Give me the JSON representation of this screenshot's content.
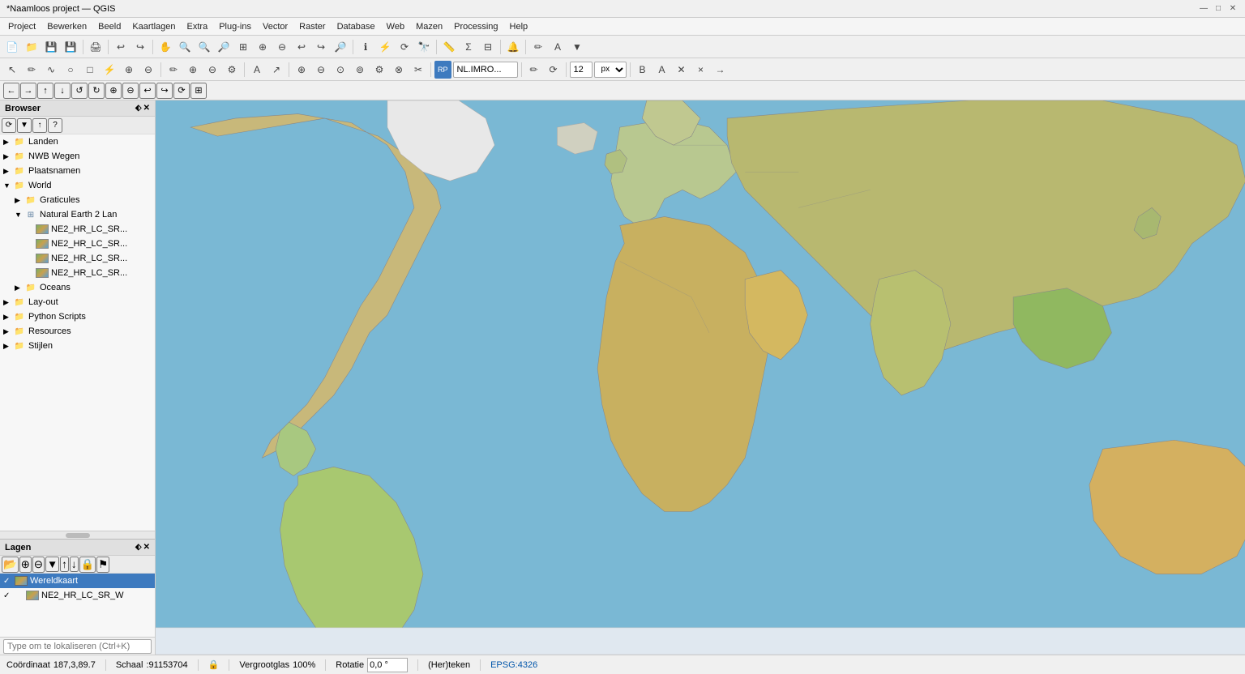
{
  "titlebar": {
    "title": "*Naamloos project — QGIS",
    "minimize": "—",
    "maximize": "□",
    "close": "✕"
  },
  "menubar": {
    "items": [
      "Project",
      "Bewerken",
      "Beeld",
      "Kaartlagen",
      "Extra",
      "Plug-ins",
      "Vector",
      "Raster",
      "Database",
      "Web",
      "Mazen",
      "Processing",
      "Help"
    ]
  },
  "toolbar1": {
    "buttons": [
      "📁",
      "💾",
      "🖨",
      "↩",
      "↪",
      "✂",
      "📋",
      "📄",
      "🔍",
      "🔍",
      "🔍",
      "🔎",
      "⊕",
      "⊖",
      "🔎",
      "↩",
      "↪",
      "🔎",
      "📤",
      "📥",
      "⚡",
      "⟳",
      "🔭",
      "⚙",
      "≡",
      "⚙",
      "Σ",
      "⊟",
      "🔔",
      "✏",
      "A",
      "▼"
    ]
  },
  "toolbar2": {
    "buttons": [
      "↖",
      "✏",
      "∿",
      "○",
      "□",
      "⚡",
      "⊕",
      "⊖",
      "✏",
      "⊕",
      "⊖",
      "⚙",
      "A",
      "↗",
      "⚡",
      "↔",
      "⊕",
      "⊖",
      "⊙",
      "⊚",
      "⚙",
      "⊗",
      "✂",
      "⊞",
      "🔗",
      "RP",
      "NL.IMRO...",
      "✏",
      "⟳",
      "⚙",
      "12",
      "px",
      "▼",
      "✓",
      "⊕",
      "✕",
      "×",
      "→",
      "⚙",
      "▼",
      "⚙",
      "▼",
      "⚙",
      "▼",
      "⚙",
      "▼"
    ]
  },
  "toolbar3": {
    "buttons": [
      "←",
      "→",
      "↑",
      "↓",
      "↺",
      "↻",
      "⊕",
      "⊖",
      "↩",
      "↪",
      "⟳",
      "⊞",
      "↗",
      "↘",
      "←",
      "→",
      "⊕",
      "⊖",
      "⟳",
      "↩"
    ]
  },
  "browser": {
    "title": "Browser",
    "tree": [
      {
        "id": "landen",
        "label": "Landen",
        "indent": 0,
        "arrow": "▶",
        "icon": "folder",
        "expanded": false
      },
      {
        "id": "nwb-wegen",
        "label": "NWB Wegen",
        "indent": 0,
        "arrow": "▶",
        "icon": "folder",
        "expanded": false
      },
      {
        "id": "plaatsnamen",
        "label": "Plaatsnamen",
        "indent": 0,
        "arrow": "▶",
        "icon": "folder",
        "expanded": false
      },
      {
        "id": "world",
        "label": "World",
        "indent": 0,
        "arrow": "▼",
        "icon": "folder",
        "expanded": true
      },
      {
        "id": "graticules",
        "label": "Graticules",
        "indent": 1,
        "arrow": "▶",
        "icon": "folder",
        "expanded": false
      },
      {
        "id": "natural-earth",
        "label": "Natural Earth 2 Lan",
        "indent": 1,
        "arrow": "▼",
        "icon": "folder-group",
        "expanded": true
      },
      {
        "id": "ne2-hr-lc-sr-1",
        "label": "NE2_HR_LC_SR...",
        "indent": 2,
        "arrow": "",
        "icon": "raster"
      },
      {
        "id": "ne2-hr-lc-sr-2",
        "label": "NE2_HR_LC_SR...",
        "indent": 2,
        "arrow": "",
        "icon": "raster"
      },
      {
        "id": "ne2-hr-lc-sr-3",
        "label": "NE2_HR_LC_SR...",
        "indent": 2,
        "arrow": "",
        "icon": "raster"
      },
      {
        "id": "ne2-hr-lc-sr-4",
        "label": "NE2_HR_LC_SR...",
        "indent": 2,
        "arrow": "",
        "icon": "raster"
      },
      {
        "id": "oceans",
        "label": "Oceans",
        "indent": 1,
        "arrow": "▶",
        "icon": "folder",
        "expanded": false
      },
      {
        "id": "lay-out",
        "label": "Lay-out",
        "indent": 0,
        "arrow": "▶",
        "icon": "folder",
        "expanded": false
      },
      {
        "id": "python-scripts",
        "label": "Python Scripts",
        "indent": 0,
        "arrow": "▶",
        "icon": "folder",
        "expanded": false
      },
      {
        "id": "resources",
        "label": "Resources",
        "indent": 0,
        "arrow": "▶",
        "icon": "folder",
        "expanded": false
      },
      {
        "id": "stijlen",
        "label": "Stijlen",
        "indent": 0,
        "arrow": "▶",
        "icon": "folder",
        "expanded": false
      }
    ]
  },
  "layers": {
    "title": "Lagen",
    "items": [
      {
        "id": "wereldkaart",
        "label": "Wereldkaart",
        "checked": true,
        "selected": true,
        "icon": "raster"
      },
      {
        "id": "ne2-hr-lc-sr-w",
        "label": "NE2_HR_LC_SR_W",
        "checked": true,
        "selected": false,
        "icon": "raster"
      }
    ]
  },
  "localize": {
    "placeholder": "Type om te lokaliseren (Ctrl+K)"
  },
  "statusbar": {
    "coord_label": "Coördinaat",
    "coord_value": "187,3,89.7",
    "scale_label": "Schaal",
    "scale_value": ":91153704",
    "lock_icon": "🔒",
    "zoom_label": "Vergrootglas",
    "zoom_value": "100%",
    "rotate_label": "Rotatie",
    "rotate_value": "0,0 °",
    "render_label": "(Her)teken",
    "epsg_label": "EPSG:4326"
  },
  "map": {
    "background_ocean": "#6ba3c8",
    "background_land": "#c8b98a"
  }
}
